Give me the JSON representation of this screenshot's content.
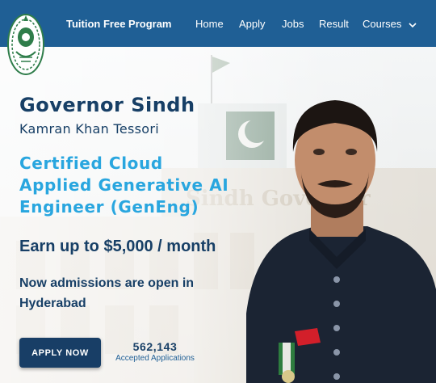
{
  "header": {
    "brand": "Tuition Free Program",
    "logo_icon": "governor-sindh-emblem",
    "nav": [
      {
        "label": "Home"
      },
      {
        "label": "Apply"
      },
      {
        "label": "Jobs"
      },
      {
        "label": "Result"
      },
      {
        "label": "Courses",
        "icon": "chevron-down-icon"
      }
    ]
  },
  "hero": {
    "title": "Governor Sindh",
    "subtitle": "Kamran Khan Tessori",
    "program_lines": [
      "Certified Cloud",
      "Applied Generative AI",
      "Engineer (GenEng)"
    ],
    "earn": "Earn up to $5,000 / month",
    "admission": "Now admissions are open in Hyderabad",
    "cta": "APPLY NOW",
    "stats": {
      "count": "562,143",
      "label": "Accepted Applications"
    }
  },
  "colors": {
    "header_bg": "#1f5f95",
    "navy": "#173f66",
    "accent_blue": "#29a6df",
    "button_bg": "#183e66"
  }
}
